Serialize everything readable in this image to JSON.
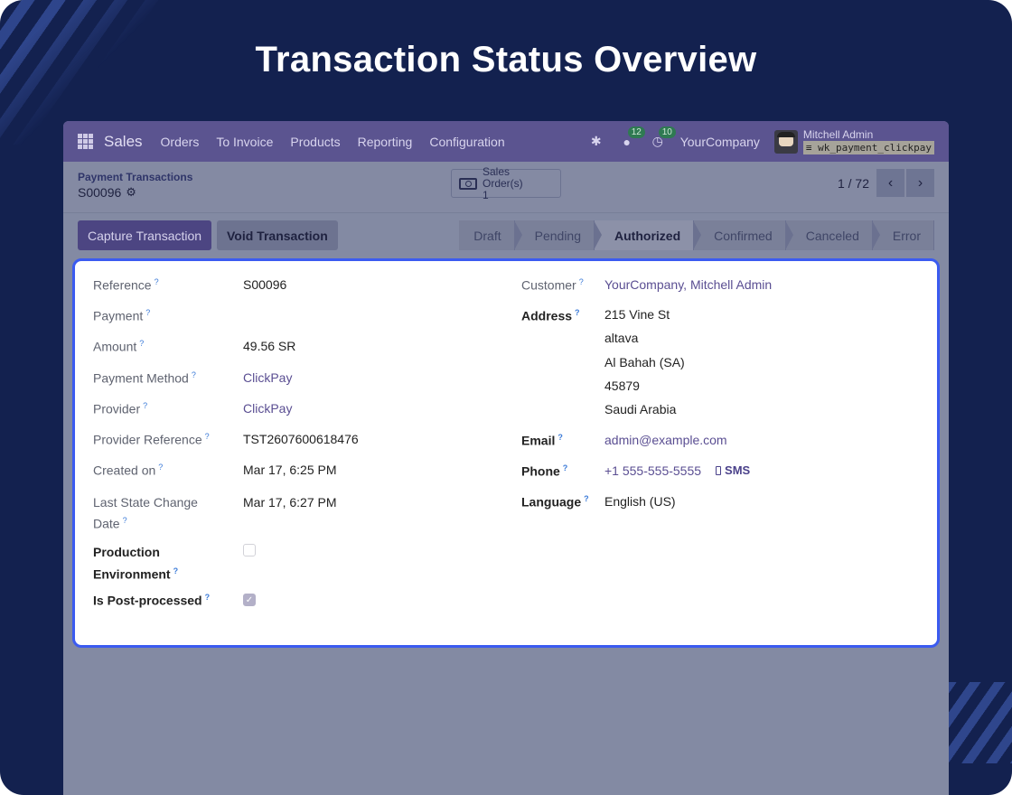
{
  "hero": {
    "title": "Transaction Status Overview"
  },
  "navbar": {
    "brand": "Sales",
    "menu": [
      "Orders",
      "To Invoice",
      "Products",
      "Reporting",
      "Configuration"
    ],
    "messages_count": "12",
    "activities_count": "10",
    "company": "YourCompany",
    "user_name": "Mitchell Admin",
    "database": "wk_payment_clickpay"
  },
  "control": {
    "breadcrumb_parent": "Payment Transactions",
    "breadcrumb_current": "S00096",
    "smart_button": {
      "label": "Sales Order(s)",
      "count": "1"
    },
    "pager": "1 / 72"
  },
  "actions": {
    "capture": "Capture Transaction",
    "void": "Void Transaction"
  },
  "statusbar": {
    "stages": [
      "Draft",
      "Pending",
      "Authorized",
      "Confirmed",
      "Canceled",
      "Error"
    ],
    "active": "Authorized"
  },
  "form": {
    "left": [
      {
        "label": "Reference",
        "value": "S00096"
      },
      {
        "label": "Payment",
        "value": ""
      },
      {
        "label": "Amount",
        "value": "49.56 SR"
      },
      {
        "label": "Payment Method",
        "value": "ClickPay"
      },
      {
        "label": "Provider",
        "value": "ClickPay"
      },
      {
        "label": "Provider Reference",
        "value": "TST2607600618476"
      },
      {
        "label": "Created on",
        "value": "Mar 17, 6:25 PM"
      },
      {
        "label": "Last State Change Date",
        "value": "Mar 17, 6:27 PM"
      },
      {
        "label": "Production Environment",
        "value": false
      },
      {
        "label": "Is Post-processed",
        "value": true
      }
    ],
    "right": {
      "customer_label": "Customer",
      "customer": "YourCompany, Mitchell Admin",
      "address_label": "Address",
      "address_lines": [
        "215 Vine St",
        "altava",
        "Al Bahah (SA)",
        "45879",
        "Saudi Arabia"
      ],
      "email_label": "Email",
      "email": "admin@example.com",
      "phone_label": "Phone",
      "phone": "+1 555-555-5555",
      "sms_label": "SMS",
      "language_label": "Language",
      "language": "English (US)"
    }
  },
  "colors": {
    "background": "#13214f",
    "navbar": "#5b5490",
    "sheet_border": "#3b5bf0",
    "link": "#5a4e92"
  }
}
